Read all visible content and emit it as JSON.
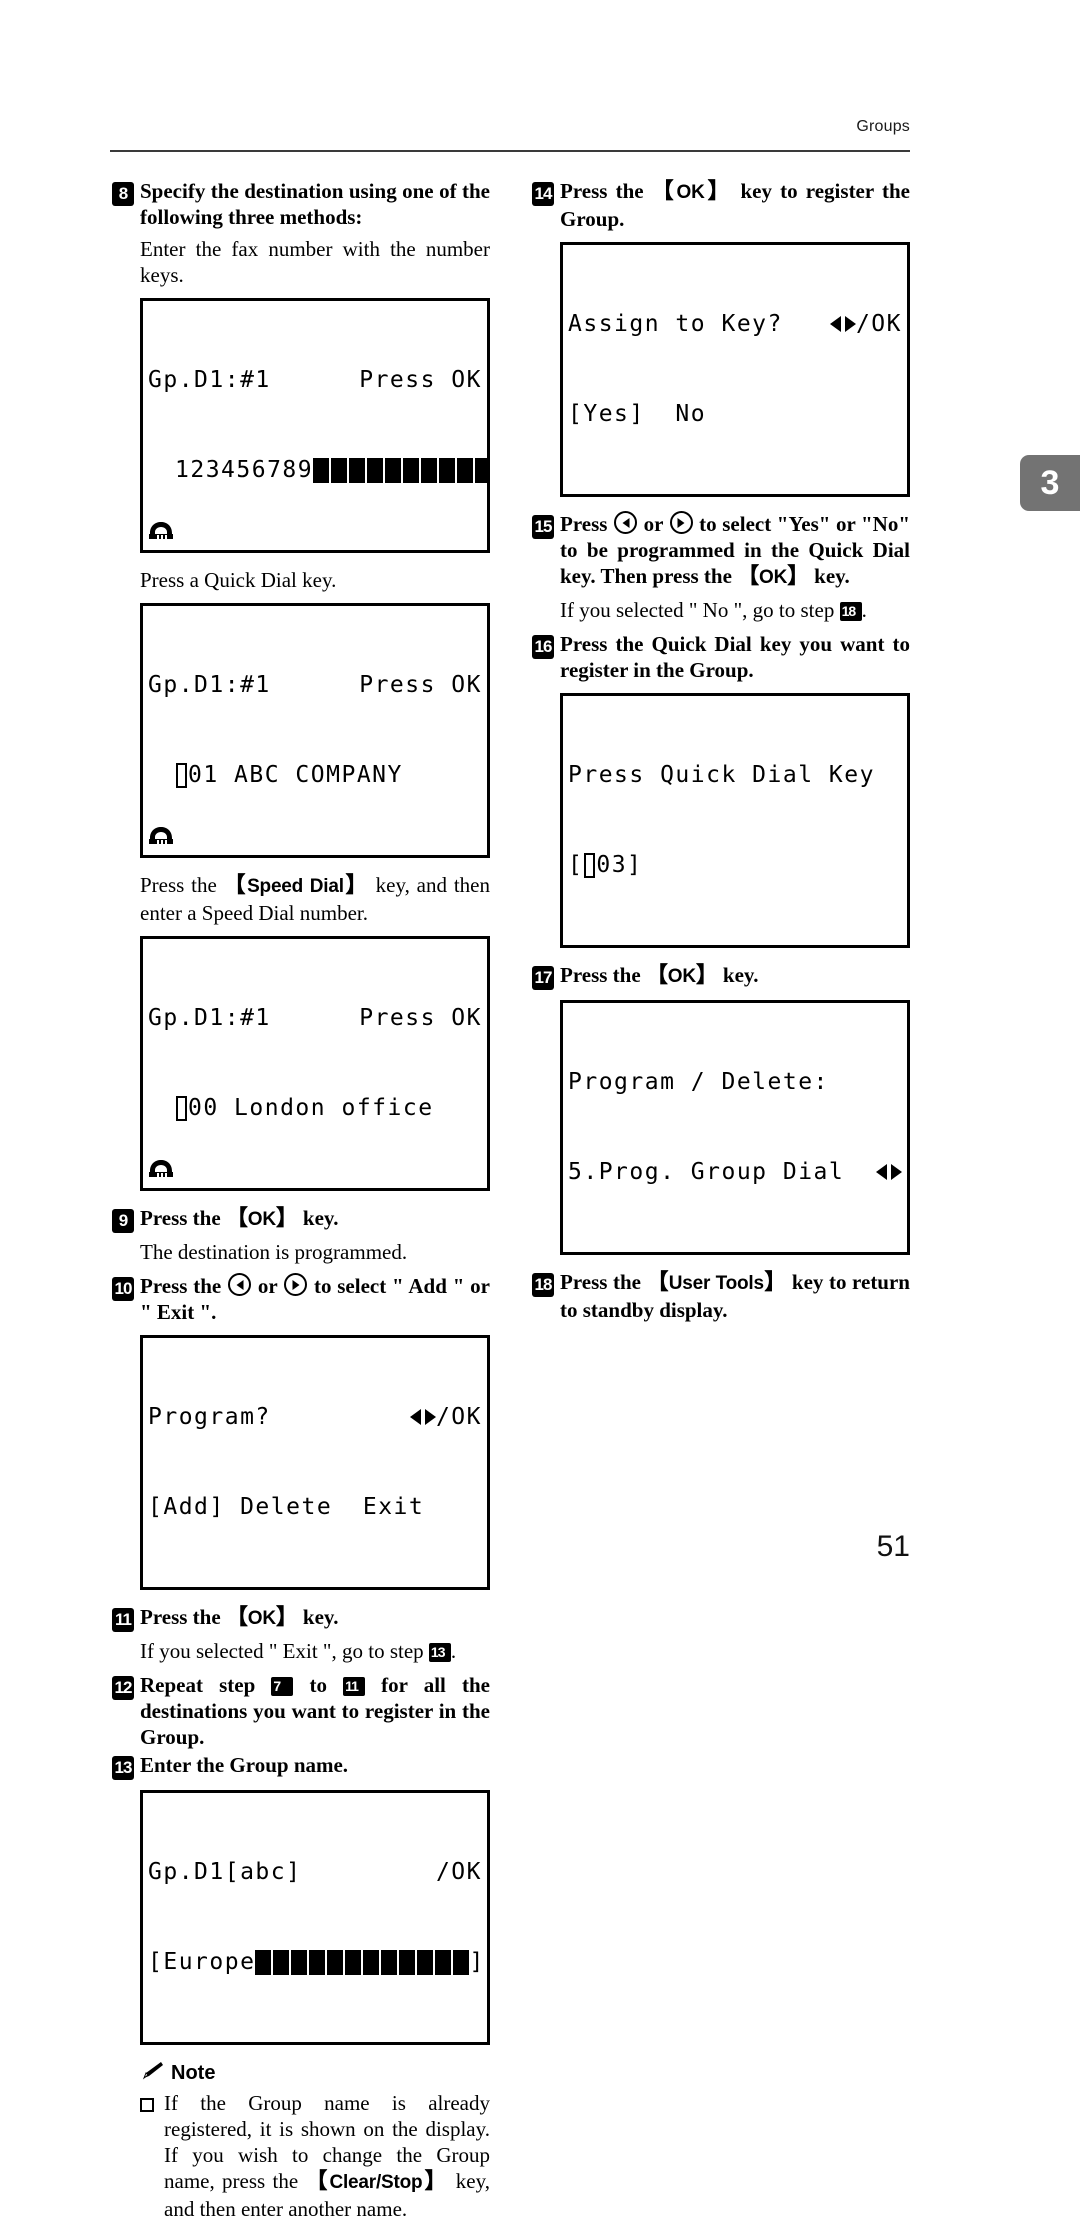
{
  "header": {
    "running_head": "Groups"
  },
  "chapter_tab": {
    "number": "3"
  },
  "folio": {
    "page_number": "51"
  },
  "left_column": {
    "step8": {
      "num": "8",
      "text": "Specify the destination using one of the following three methods:",
      "method1_text": "Enter the fax number with the number keys.",
      "lcd1": {
        "line1_left": "Gp.D1:#1",
        "line1_right": "Press OK",
        "line2_value": "123456789",
        "line2_blocks": 10
      },
      "method2_text": "Press a Quick Dial key.",
      "lcd2": {
        "line1_left": "Gp.D1:#1",
        "line1_right": "Press OK",
        "line2_value": "01 ABC COMPANY"
      },
      "method3_pre": "Press the ",
      "method3_key": "Speed Dial",
      "method3_post": " key, and then enter a Speed Dial number.",
      "lcd3": {
        "line1_left": "Gp.D1:#1",
        "line1_right": "Press OK",
        "line2_value": "00 London office"
      }
    },
    "step9": {
      "num": "9",
      "text_pre": "Press the ",
      "key": "OK",
      "text_post": " key.",
      "sub": "The destination is programmed."
    },
    "step10": {
      "num": "10",
      "text_pre": "Press the ",
      "text_mid": " or ",
      "text_post": " to select \" Add \" or \" Exit \".",
      "lcd": {
        "line1_left": "Program?",
        "line1_right": "/OK",
        "line2": "[Add] Delete  Exit"
      }
    },
    "step11": {
      "num": "11",
      "text_pre": "Press the ",
      "key": "OK",
      "text_post": " key.",
      "sub_pre": "If you selected \" Exit \", go to step ",
      "sub_ref": "13",
      "sub_post": "."
    },
    "step12": {
      "num": "12",
      "text_pre": "Repeat step ",
      "ref_from": "7",
      "text_mid": " to ",
      "ref_to": "11",
      "text_post": " for all the destinations you want to register in the Group."
    },
    "step13": {
      "num": "13",
      "text": "Enter the Group name.",
      "lcd": {
        "line1_left": "Gp.D1[abc]",
        "line1_right": "/OK",
        "line2_open": "[Europe",
        "line2_blocks": 12,
        "line2_close": "]"
      }
    },
    "note": {
      "label": "Note",
      "items": [
        {
          "pre": "If the Group name is already registered, it is shown on the display. If you wish to change the Group name, press the ",
          "key": "Clear/Stop",
          "post": " key, and then enter another name."
        }
      ]
    }
  },
  "right_column": {
    "step14": {
      "num": "14",
      "text_pre": "Press the ",
      "key": "OK",
      "text_post": " key to register the Group.",
      "lcd": {
        "line1_left": "Assign to Key?",
        "line1_right": "/OK",
        "line2": "[Yes]  No"
      }
    },
    "step15": {
      "num": "15",
      "text_pre": "Press ",
      "text_mid": " or ",
      "text_post1": " to select \"Yes\" or \"No\" to be programmed in the Quick Dial key. Then press the ",
      "key": "OK",
      "text_post2": " key.",
      "sub_pre": "If you selected \" No \", go to step ",
      "sub_ref": "18",
      "sub_post": "."
    },
    "step16": {
      "num": "16",
      "text": "Press the Quick Dial key you want to register in the Group.",
      "lcd": {
        "line1": "Press Quick Dial Key",
        "line2_open": "[",
        "line2_value": "03]"
      }
    },
    "step17": {
      "num": "17",
      "text_pre": "Press the ",
      "key": "OK",
      "text_post": " key.",
      "lcd": {
        "line1": "Program / Delete:",
        "line2_left": "5.Prog. Group Dial",
        "line2_right": ""
      }
    },
    "step18": {
      "num": "18",
      "text_pre": "Press the ",
      "key": "User Tools",
      "text_post": " key to return to standby display."
    }
  }
}
